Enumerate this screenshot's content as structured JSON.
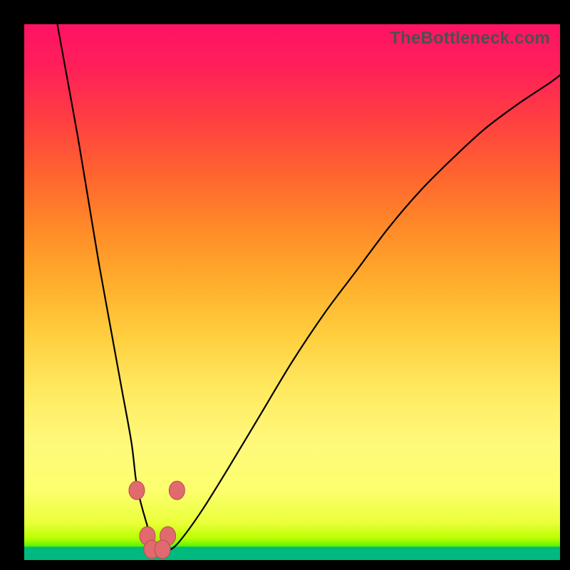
{
  "attribution": "TheBottleneck.com",
  "colors": {
    "frame": "#000000",
    "attribution_text": "#4f4f4f",
    "curve_stroke": "#000000",
    "marker_fill": "#e16a6f",
    "marker_stroke": "#b94a50"
  },
  "chart_data": {
    "type": "line",
    "title": "",
    "xlabel": "",
    "ylabel": "",
    "xlim": [
      0,
      100
    ],
    "ylim": [
      0,
      100
    ],
    "grid": false,
    "legend": false,
    "series": [
      {
        "name": "v-curve",
        "x": [
          6,
          8,
          10,
          12,
          14,
          16,
          18,
          20,
          21,
          22.5,
          24,
          25.5,
          27,
          29,
          33,
          38,
          44,
          50,
          56,
          62,
          68,
          74,
          80,
          86,
          92,
          98,
          100
        ],
        "y": [
          101,
          90,
          79,
          67,
          55,
          44,
          33,
          22,
          14,
          8,
          3.5,
          1.8,
          1.8,
          3.5,
          9,
          17,
          27,
          37,
          46,
          54,
          62,
          69,
          75,
          80.5,
          85,
          89,
          90.5
        ]
      }
    ],
    "markers": [
      {
        "x": 21.0,
        "y": 13.0
      },
      {
        "x": 28.5,
        "y": 13.0
      },
      {
        "x": 23.0,
        "y": 4.5
      },
      {
        "x": 26.8,
        "y": 4.5
      },
      {
        "x": 23.8,
        "y": 2.0
      },
      {
        "x": 25.8,
        "y": 2.0
      }
    ]
  }
}
